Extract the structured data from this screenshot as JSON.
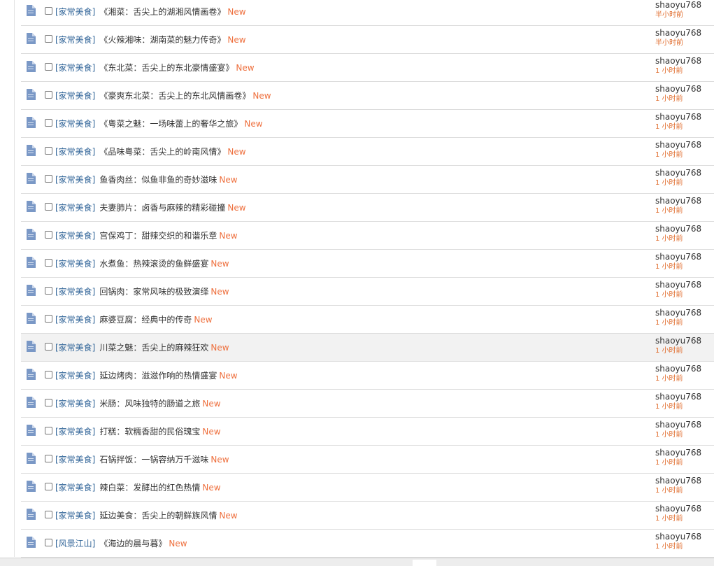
{
  "threads": [
    {
      "category": "[家常美食]",
      "title": "《湘菜：舌尖上的湖湘风情画卷》",
      "badge": "New",
      "author": "shaoyu768",
      "time": "半小时前"
    },
    {
      "category": "[家常美食]",
      "title": "《火辣湘味：湖南菜的魅力传奇》",
      "badge": "New",
      "author": "shaoyu768",
      "time": "半小时前"
    },
    {
      "category": "[家常美食]",
      "title": "《东北菜：舌尖上的东北豪情盛宴》",
      "badge": "New",
      "author": "shaoyu768",
      "time": "1 小时前"
    },
    {
      "category": "[家常美食]",
      "title": "《豪爽东北菜：舌尖上的东北风情画卷》",
      "badge": "New",
      "author": "shaoyu768",
      "time": "1 小时前"
    },
    {
      "category": "[家常美食]",
      "title": "《粤菜之魅：一场味蕾上的奢华之旅》",
      "badge": "New",
      "author": "shaoyu768",
      "time": "1 小时前"
    },
    {
      "category": "[家常美食]",
      "title": "《品味粤菜：舌尖上的岭南风情》",
      "badge": "New",
      "author": "shaoyu768",
      "time": "1 小时前"
    },
    {
      "category": "[家常美食]",
      "title": "鱼香肉丝：似鱼非鱼的奇妙滋味",
      "badge": "New",
      "author": "shaoyu768",
      "time": "1 小时前"
    },
    {
      "category": "[家常美食]",
      "title": "夫妻肺片：卤香与麻辣的精彩碰撞",
      "badge": "New",
      "author": "shaoyu768",
      "time": "1 小时前"
    },
    {
      "category": "[家常美食]",
      "title": "宫保鸡丁：甜辣交织的和谐乐章",
      "badge": "New",
      "author": "shaoyu768",
      "time": "1 小时前"
    },
    {
      "category": "[家常美食]",
      "title": "水煮鱼：热辣滚烫的鱼鲜盛宴",
      "badge": "New",
      "author": "shaoyu768",
      "time": "1 小时前"
    },
    {
      "category": "[家常美食]",
      "title": "回锅肉：家常风味的极致演绎",
      "badge": "New",
      "author": "shaoyu768",
      "time": "1 小时前"
    },
    {
      "category": "[家常美食]",
      "title": "麻婆豆腐：经典中的传奇",
      "badge": "New",
      "author": "shaoyu768",
      "time": "1 小时前"
    },
    {
      "category": "[家常美食]",
      "title": "川菜之魅：舌尖上的麻辣狂欢",
      "badge": "New",
      "author": "shaoyu768",
      "time": "1 小时前",
      "hover": true
    },
    {
      "category": "[家常美食]",
      "title": "延边烤肉：滋滋作响的热情盛宴",
      "badge": "New",
      "author": "shaoyu768",
      "time": "1 小时前"
    },
    {
      "category": "[家常美食]",
      "title": "米肠：风味独特的肠道之旅",
      "badge": "New",
      "author": "shaoyu768",
      "time": "1 小时前"
    },
    {
      "category": "[家常美食]",
      "title": "打糕：软糯香甜的民俗瑰宝",
      "badge": "New",
      "author": "shaoyu768",
      "time": "1 小时前"
    },
    {
      "category": "[家常美食]",
      "title": "石锅拌饭：一锅容纳万千滋味",
      "badge": "New",
      "author": "shaoyu768",
      "time": "1 小时前"
    },
    {
      "category": "[家常美食]",
      "title": "辣白菜：发酵出的红色热情",
      "badge": "New",
      "author": "shaoyu768",
      "time": "1 小时前"
    },
    {
      "category": "[家常美食]",
      "title": "延边美食：舌尖上的朝鲜族风情",
      "badge": "New",
      "author": "shaoyu768",
      "time": "1 小时前"
    },
    {
      "category": "[风景江山]",
      "title": "《海边的晨与暮》",
      "badge": "New",
      "author": "shaoyu768",
      "time": "1 小时前"
    }
  ],
  "icons": {
    "row_icon": "document-icon",
    "select": "checkbox"
  },
  "colors": {
    "category": "#336699",
    "badge": "#ee6f3d",
    "time": "#e06b2b",
    "doc_icon": "#7a98c6"
  }
}
